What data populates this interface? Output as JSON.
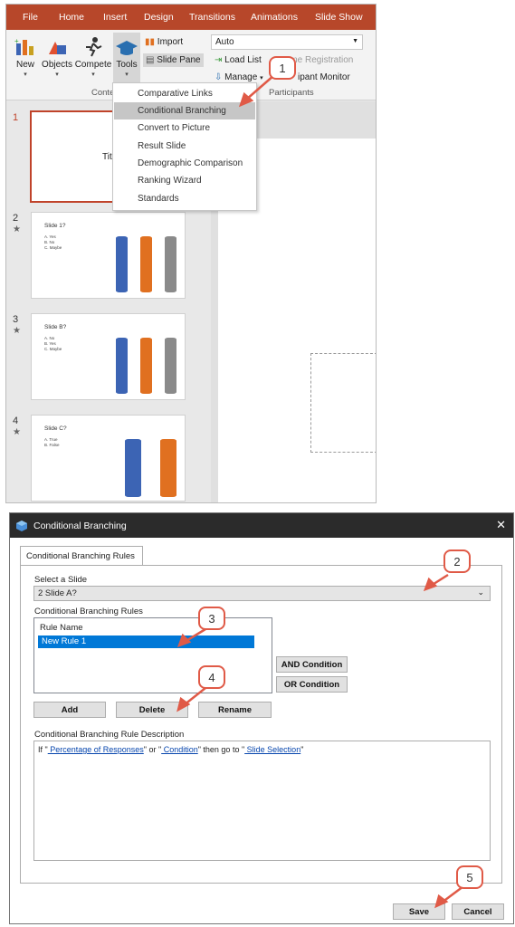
{
  "ppt": {
    "tabs": [
      "File",
      "Home",
      "Insert",
      "Design",
      "Transitions",
      "Animations",
      "Slide Show"
    ],
    "ribbon": {
      "new_label": "New",
      "objects_label": "Objects",
      "compete_label": "Compete",
      "tools_label": "Tools",
      "import_label": "Import",
      "slide_pane_label": "Slide Pane",
      "auto_value": "Auto",
      "load_list_label": "Load List",
      "manage_label": "Manage",
      "game_registration_label": "Game Registration",
      "participant_monitor_label": "ipant Monitor",
      "group_content_label": "Conte",
      "group_participants_label": "Participants"
    },
    "tools_menu": [
      "Comparative Links",
      "Conditional Branching",
      "Convert to Picture",
      "Result Slide",
      "Demographic Comparison",
      "Ranking Wizard",
      "Standards"
    ],
    "tools_menu_selected_index": 1,
    "slides": [
      {
        "num": "1",
        "title_fragment": "Titl"
      },
      {
        "num": "2",
        "star": "★",
        "title": "Slide 1?",
        "options": [
          "A.  Yes",
          "B.  No",
          "C.  Maybe"
        ]
      },
      {
        "num": "3",
        "star": "★",
        "title": "Slide B?",
        "options": [
          "A.  No",
          "B.  Yes",
          "C.  Maybe"
        ]
      },
      {
        "num": "4",
        "star": "★",
        "title": "Slide C?",
        "options": [
          "A.  True",
          "B.  False"
        ]
      }
    ]
  },
  "dialog": {
    "title": "Conditional Branching",
    "close_glyph": "✕",
    "tab_label": "Conditional Branching Rules",
    "select_slide_label": "Select a Slide",
    "selected_slide": "2 Slide A?",
    "rules_label": "Conditional Branching Rules",
    "rule_name_header": "Rule Name",
    "rules": [
      "New Rule 1"
    ],
    "and_condition": "AND Condition",
    "or_condition": "OR Condition",
    "add": "Add",
    "delete": "Delete",
    "rename": "Rename",
    "description_label": "Conditional Branching Rule Description",
    "desc_if": "If \"",
    "desc_link1": " Percentage of Responses",
    "desc_or": "\" or \"",
    "desc_link2": " Condition",
    "desc_then": "\"  then go to \"",
    "desc_link3": " Slide Selection",
    "desc_end": "\"",
    "save": "Save",
    "cancel": "Cancel"
  },
  "callouts": [
    "1",
    "2",
    "3",
    "4",
    "5"
  ],
  "colors": {
    "accent": "#b7472a",
    "callout": "#e05a47",
    "selection": "#0078d7"
  }
}
